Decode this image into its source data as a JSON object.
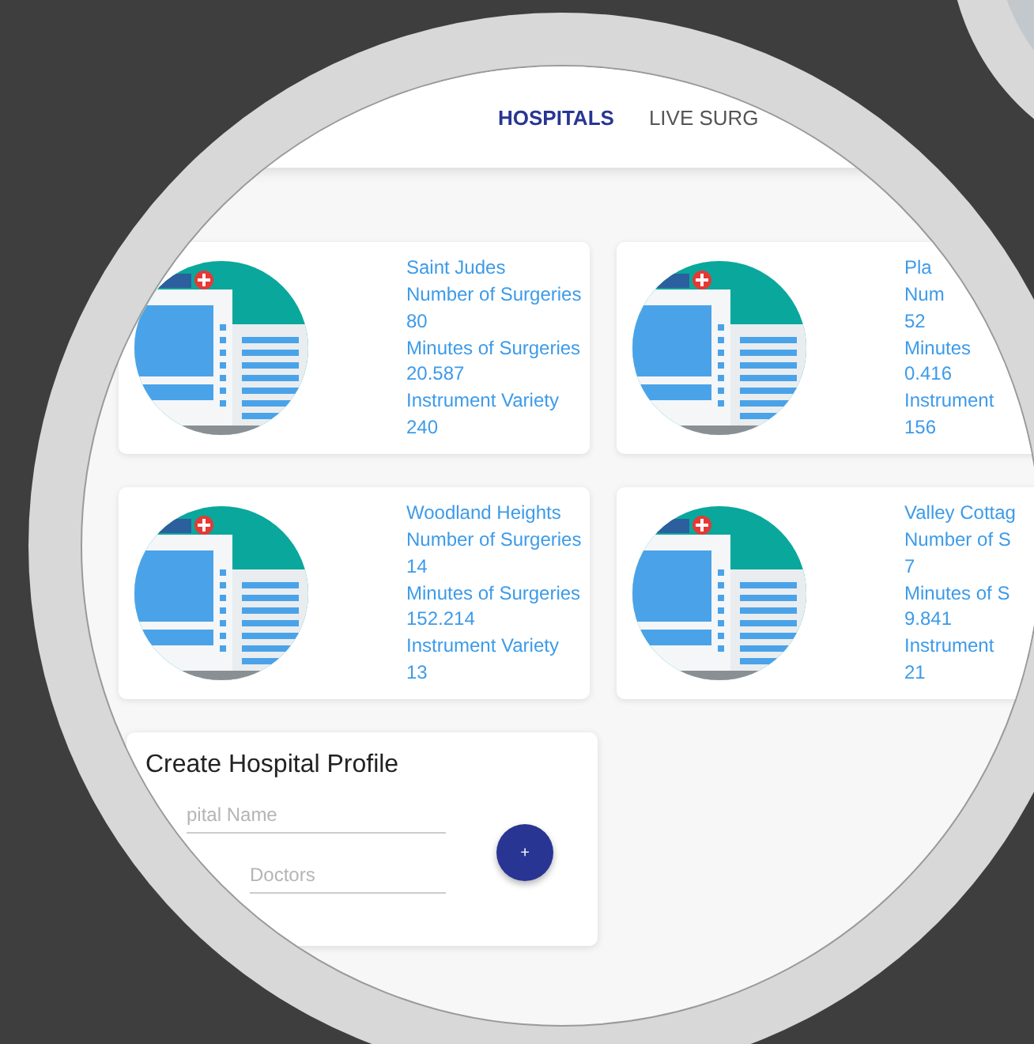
{
  "nav": {
    "tabs": [
      {
        "label": "HOSPITALS",
        "selected": true
      },
      {
        "label": "LIVE SURG",
        "selected": false
      }
    ]
  },
  "hospitals": [
    {
      "name": "Saint Judes",
      "surgeries_label": "Number of Surgeries",
      "surgeries": "80",
      "minutes_label": "Minutes of Surgeries",
      "minutes": "20.587",
      "variety_label": "Instrument Variety",
      "variety": "240"
    },
    {
      "name": "Pla",
      "surgeries_label": "Num",
      "surgeries": "52",
      "minutes_label": "Minutes",
      "minutes": "0.416",
      "variety_label": "Instrument",
      "variety": "156"
    },
    {
      "name": "Woodland Heights",
      "surgeries_label": "Number of Surgeries",
      "surgeries": "14",
      "minutes_label": "Minutes of Surgeries",
      "minutes": "152.214",
      "variety_label": "Instrument Variety",
      "variety": "13"
    },
    {
      "name": "Valley Cottag",
      "surgeries_label": "Number of S",
      "surgeries": "7",
      "minutes_label": "Minutes of S",
      "minutes": "9.841",
      "variety_label": "Instrument",
      "variety": "21"
    }
  ],
  "form": {
    "title": "Create Hospital Profile",
    "fields": [
      {
        "placeholder": "pital Name"
      },
      {
        "placeholder": "Doctors"
      }
    ],
    "button": "+"
  }
}
